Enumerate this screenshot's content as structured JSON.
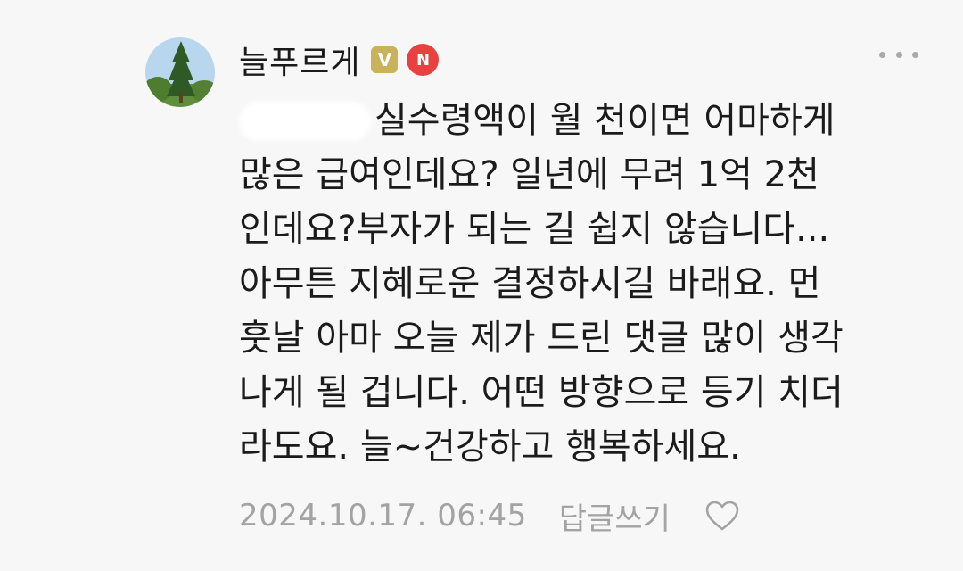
{
  "comment": {
    "author": {
      "name": "늘푸르게",
      "badge_v": "V",
      "badge_n": "N"
    },
    "body_lines": [
      "실수령액이 월 천이면 어마하게",
      "많은 급여인데요? 일년에 무려 1억 2천",
      "인데요?부자가 되는 길 쉽지 않습니다...",
      "아무튼 지혜로운 결정하시길 바래요. 먼",
      "훗날 아마 오늘 제가 드린 댓글 많이 생각",
      "나게 될 겁니다. 어떤 방향으로 등기 치더",
      "라도요. 늘~건강하고 행복하세요."
    ],
    "date": "2024.10.17. 06:45",
    "reply_label": "답글쓰기"
  },
  "icons": {
    "more": "more-horizontal-icon",
    "like": "heart-outline-icon"
  },
  "colors": {
    "background": "#f7f7f7",
    "badge_v": "#c9b25a",
    "badge_n": "#e8413f",
    "meta_text": "#a3a3a3"
  }
}
